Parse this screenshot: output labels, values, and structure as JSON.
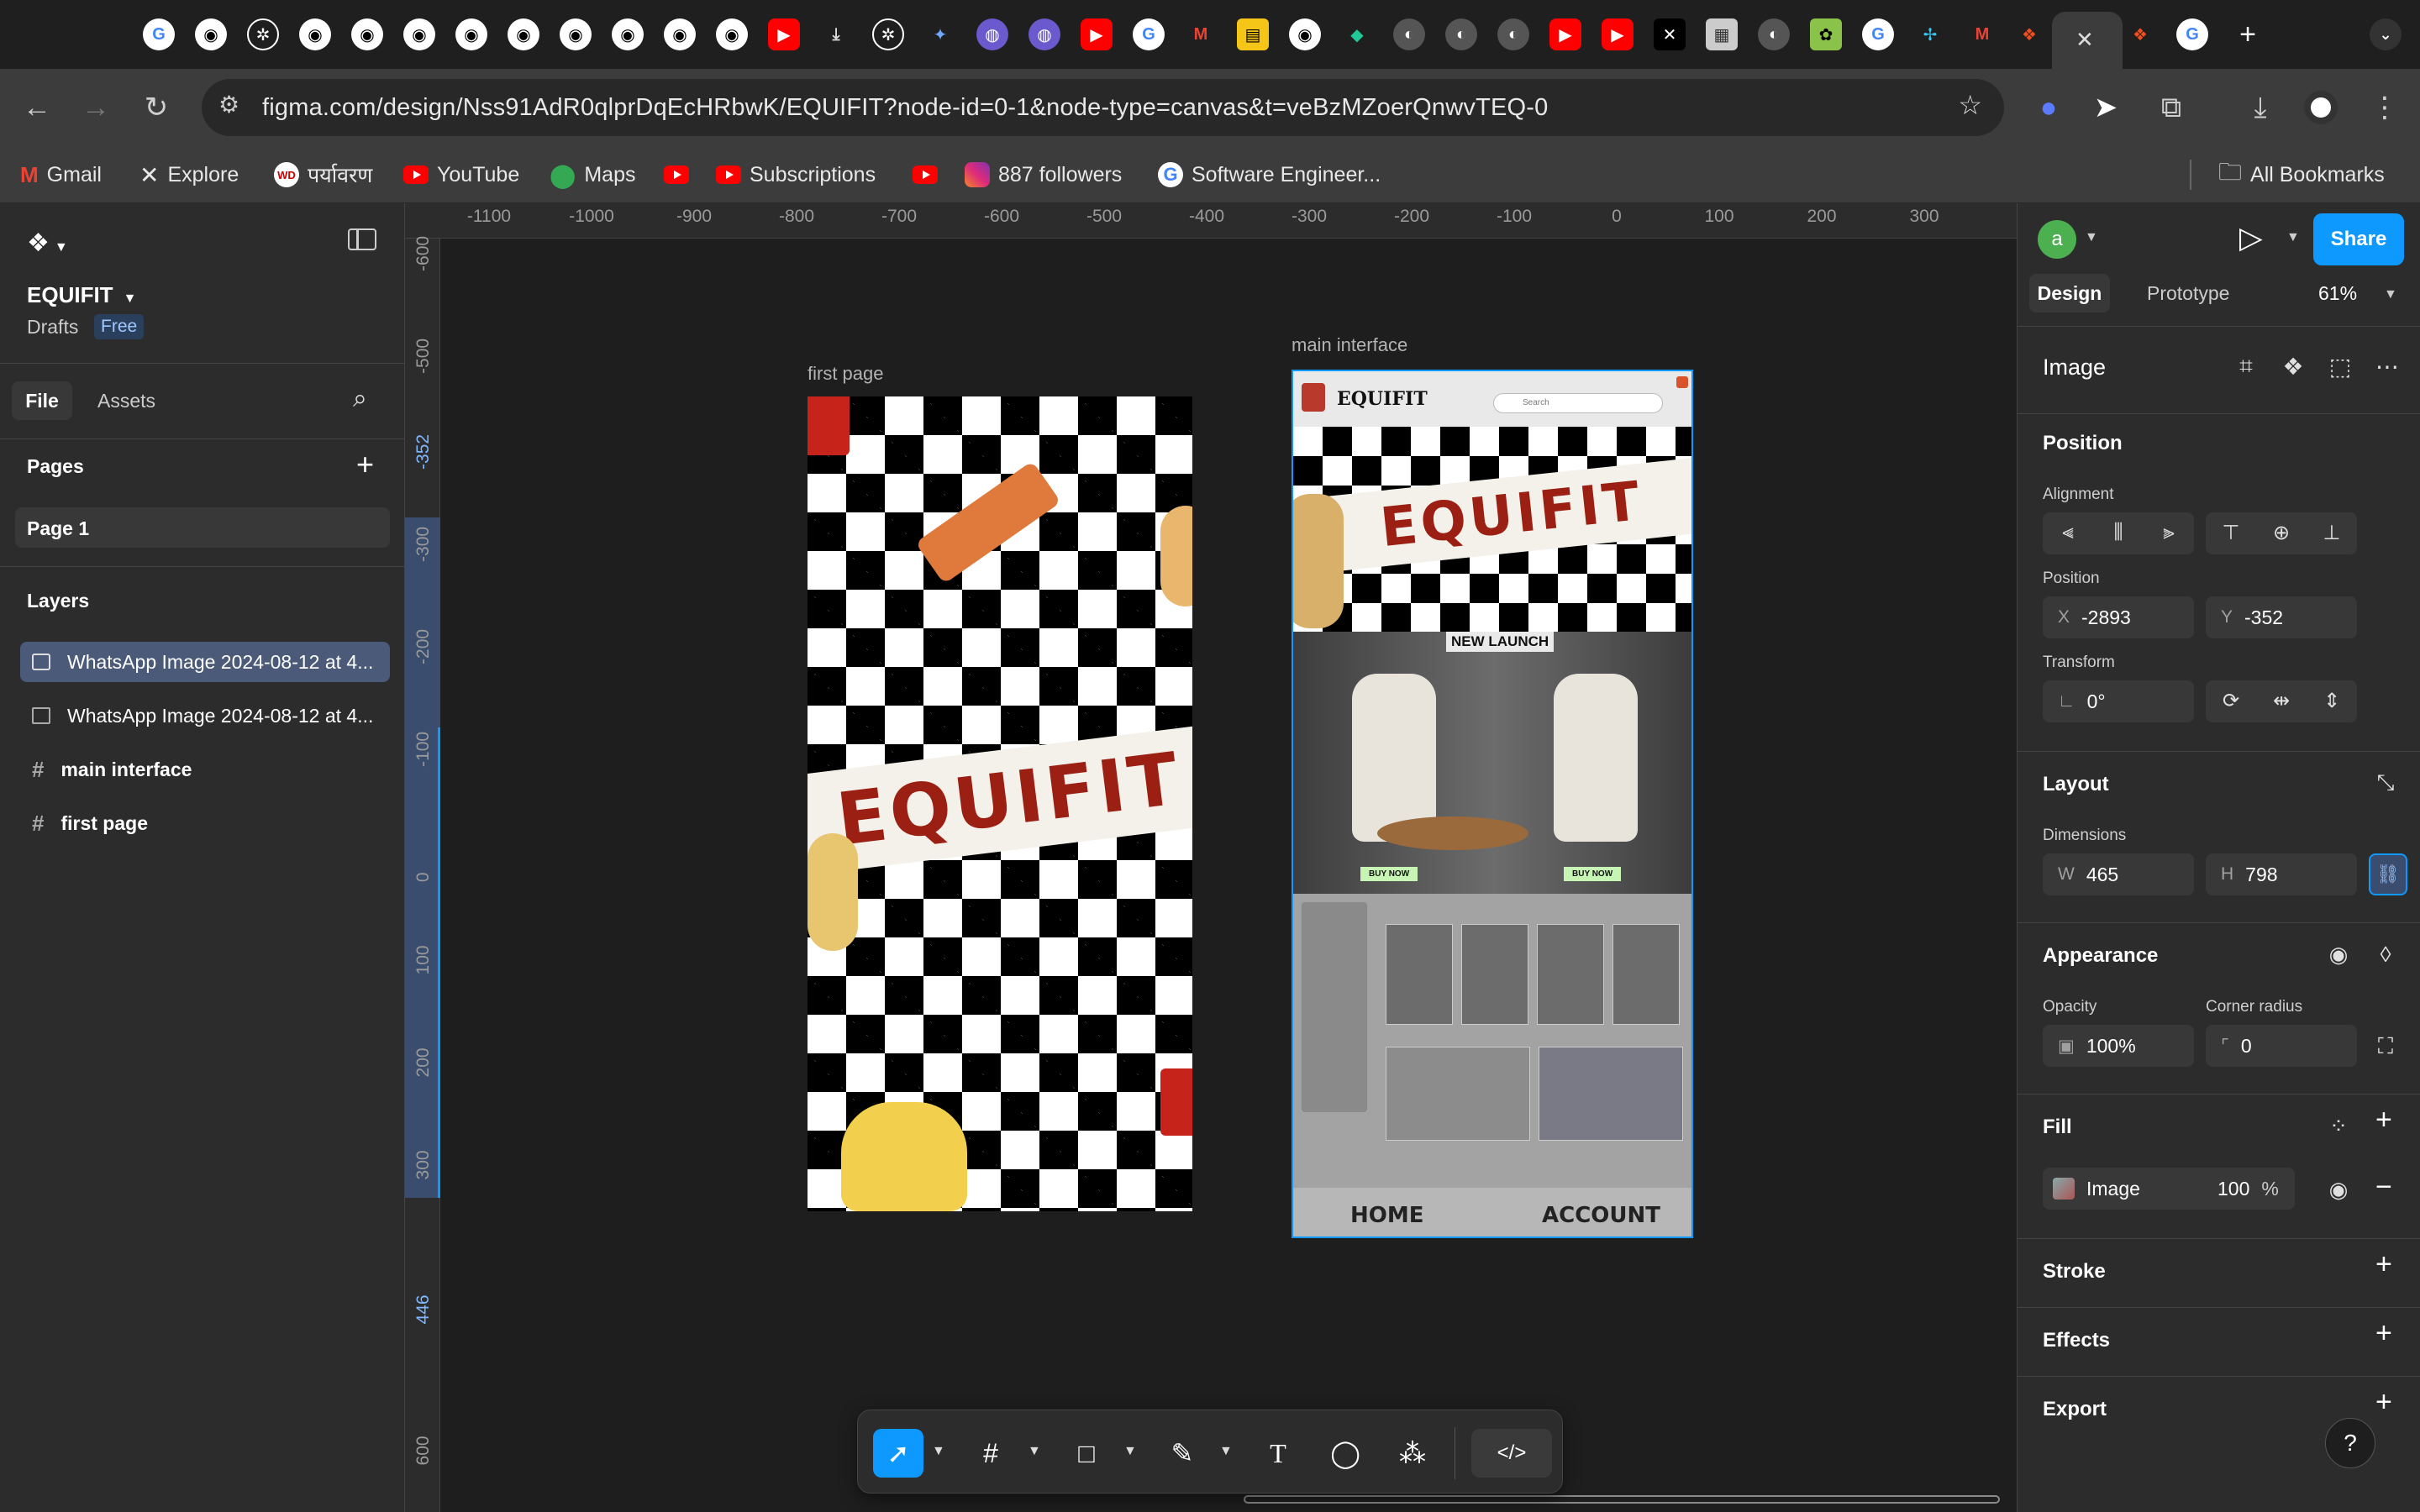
{
  "browser": {
    "url": "figma.com/design/Nss91AdR0qlprDqEcHRbwK/EQUIFIT?node-id=0-1&node-type=canvas&t=veBzMZoerQnwvTEQ-0",
    "new_tab_symbol": "+",
    "close_tab_symbol": "✕",
    "bookmarks": [
      {
        "label": "Gmail",
        "icon": "gmail-icon"
      },
      {
        "label": "Explore",
        "icon": "x-icon"
      },
      {
        "label": "पर्यावरण",
        "icon": "wd-icon"
      },
      {
        "label": "YouTube",
        "icon": "youtube-icon"
      },
      {
        "label": "Maps",
        "icon": "maps-icon"
      },
      {
        "label": "",
        "icon": "youtube-icon"
      },
      {
        "label": "Subscriptions",
        "icon": "youtube-icon"
      },
      {
        "label": "",
        "icon": "youtube-icon"
      },
      {
        "label": "887 followers",
        "icon": "instagram-icon"
      },
      {
        "label": "Software Engineer...",
        "icon": "google-icon"
      }
    ],
    "all_bookmarks": "All Bookmarks"
  },
  "figma": {
    "file_name": "EQUIFIT",
    "drafts": "Drafts",
    "plan_badge": "Free",
    "tabs": {
      "file": "File",
      "assets": "Assets"
    },
    "pages_title": "Pages",
    "page1": "Page 1",
    "layers_title": "Layers",
    "layers": [
      "WhatsApp Image 2024-08-12 at 4...",
      "WhatsApp Image 2024-08-12 at 4...",
      "main interface",
      "first page"
    ],
    "ruler_top": [
      "-1100",
      "-1000",
      "-900",
      "-800",
      "-700",
      "-600",
      "-500",
      "-400",
      "-300",
      "-200",
      "-100",
      "0",
      "100",
      "200",
      "300"
    ],
    "ruler_left": [
      "-600",
      "-500",
      "-352",
      "-300",
      "-200",
      "-100",
      "0",
      "100",
      "200",
      "300",
      "446",
      "600"
    ],
    "frames": {
      "first_label": "first page",
      "main_label": "main interface",
      "brand": "EQUIFIT",
      "new_launch": "NEW LAUNCH",
      "buy_now": "BUY NOW",
      "search": "Search",
      "nav_home": "HOME",
      "nav_account": "ACCOUNT"
    }
  },
  "design_panel": {
    "avatar": "a",
    "share": "Share",
    "tab_design": "Design",
    "tab_prototype": "Prototype",
    "zoom": "61%",
    "section_title": "Image",
    "position_title": "Position",
    "alignment": "Alignment",
    "position_label": "Position",
    "x_label": "X",
    "x_value": "-2893",
    "y_label": "Y",
    "y_value": "-352",
    "transform": "Transform",
    "rotation": "0°",
    "layout_title": "Layout",
    "dimensions": "Dimensions",
    "w_label": "W",
    "w_value": "465",
    "h_label": "H",
    "h_value": "798",
    "appearance_title": "Appearance",
    "opacity_label": "Opacity",
    "opacity_value": "100%",
    "corner_label": "Corner radius",
    "corner_value": "0",
    "fill_title": "Fill",
    "fill_type": "Image",
    "fill_opacity": "100",
    "fill_pct": "%",
    "stroke_title": "Stroke",
    "effects_title": "Effects",
    "export_title": "Export",
    "help": "?"
  },
  "colors": {
    "accent": "#0d99ff",
    "brand_red": "#9b1f12",
    "avatar_green": "#4caf50"
  }
}
